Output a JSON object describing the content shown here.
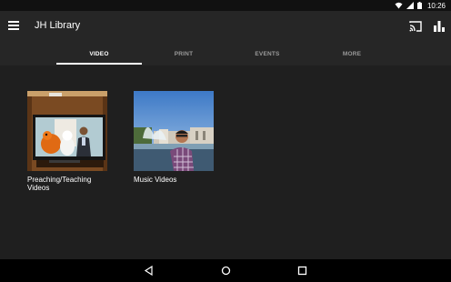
{
  "status_bar": {
    "time": "10:26",
    "icons": [
      "wifi-icon",
      "signal-icon",
      "battery-icon"
    ]
  },
  "app_bar": {
    "title": "JH Library",
    "icons": [
      "menu-icon",
      "cast-icon",
      "bar-chart-icon"
    ]
  },
  "tabs": [
    {
      "label": "VIDEO",
      "active": true
    },
    {
      "label": "PRINT",
      "active": false
    },
    {
      "label": "EVENTS",
      "active": false
    },
    {
      "label": "MORE",
      "active": false
    }
  ],
  "items": [
    {
      "label": "Preaching/Teaching Videos",
      "thumbnail": "tv-puppets-thumbnail"
    },
    {
      "label": "Music Videos",
      "thumbnail": "man-fountain-thumbnail"
    }
  ],
  "nav_bar": {
    "icons": [
      "back-icon",
      "home-icon",
      "recents-icon"
    ]
  },
  "colors": {
    "background": "#1f1f1f",
    "app_bar": "#262626",
    "status_bar": "#111111",
    "nav_bar": "#000000",
    "text_primary": "#ffffff",
    "text_inactive": "#9a9a9a"
  }
}
